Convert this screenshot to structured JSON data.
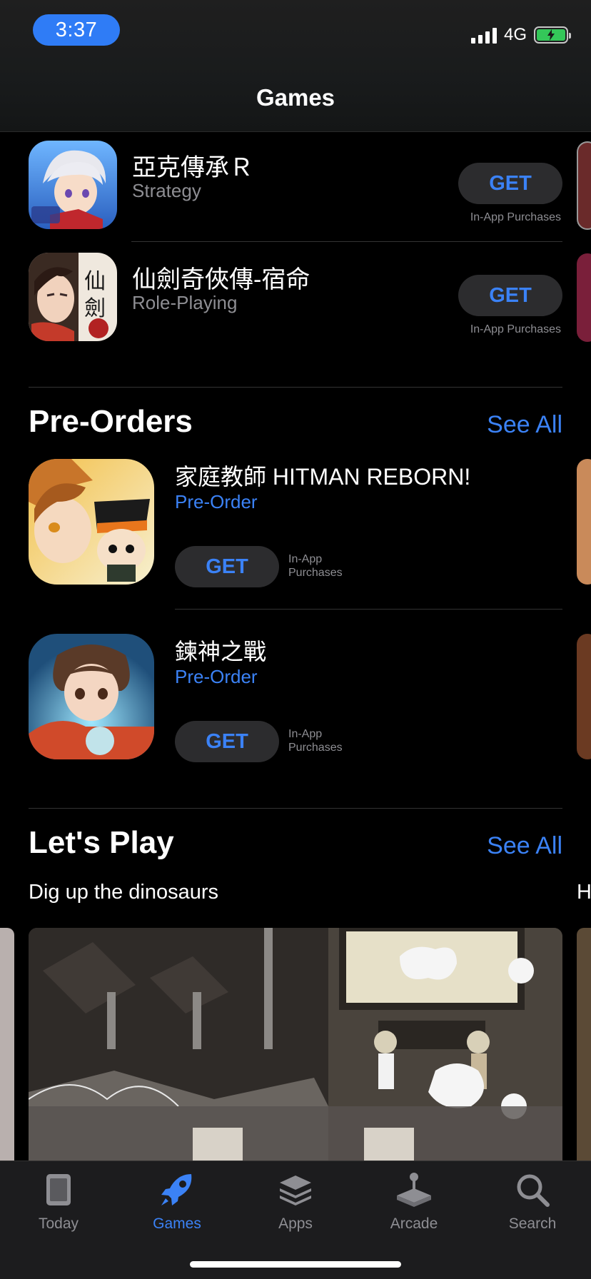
{
  "status_bar": {
    "time": "3:37",
    "network": "4G"
  },
  "nav": {
    "title": "Games"
  },
  "top_list": [
    {
      "title": "亞克傳承Ｒ",
      "subtitle": "Strategy",
      "button": "GET",
      "note": "In-App Purchases"
    },
    {
      "title": "仙劍奇俠傳-宿命",
      "subtitle": "Role-Playing",
      "button": "GET",
      "note": "In-App Purchases"
    }
  ],
  "pre_orders": {
    "title": "Pre-Orders",
    "see_all": "See All",
    "items": [
      {
        "title": "家庭教師 HITMAN REBORN!",
        "subtitle": "Pre-Order",
        "button": "GET",
        "note_line1": "In-App",
        "note_line2": "Purchases"
      },
      {
        "title": "鍊神之戰",
        "subtitle": "Pre-Order",
        "button": "GET",
        "note_line1": "In-App",
        "note_line2": "Purchases"
      }
    ]
  },
  "lets_play": {
    "title": "Let's Play",
    "see_all": "See All",
    "subtitle": "Dig up the dinosaurs",
    "next_subtitle_peek": "H"
  },
  "tabbar": {
    "items": [
      {
        "label": "Today",
        "icon": "today-icon",
        "active": false
      },
      {
        "label": "Games",
        "icon": "rocket-icon",
        "active": true
      },
      {
        "label": "Apps",
        "icon": "apps-stack-icon",
        "active": false
      },
      {
        "label": "Arcade",
        "icon": "joystick-icon",
        "active": false
      },
      {
        "label": "Search",
        "icon": "search-icon",
        "active": false
      }
    ]
  },
  "colors": {
    "accent": "#3b82f6",
    "background": "#000000",
    "button_bg": "#2c2c2e",
    "secondary_text": "#8e8e93",
    "time_pill": "#2f7cf6",
    "battery": "#34c759"
  }
}
